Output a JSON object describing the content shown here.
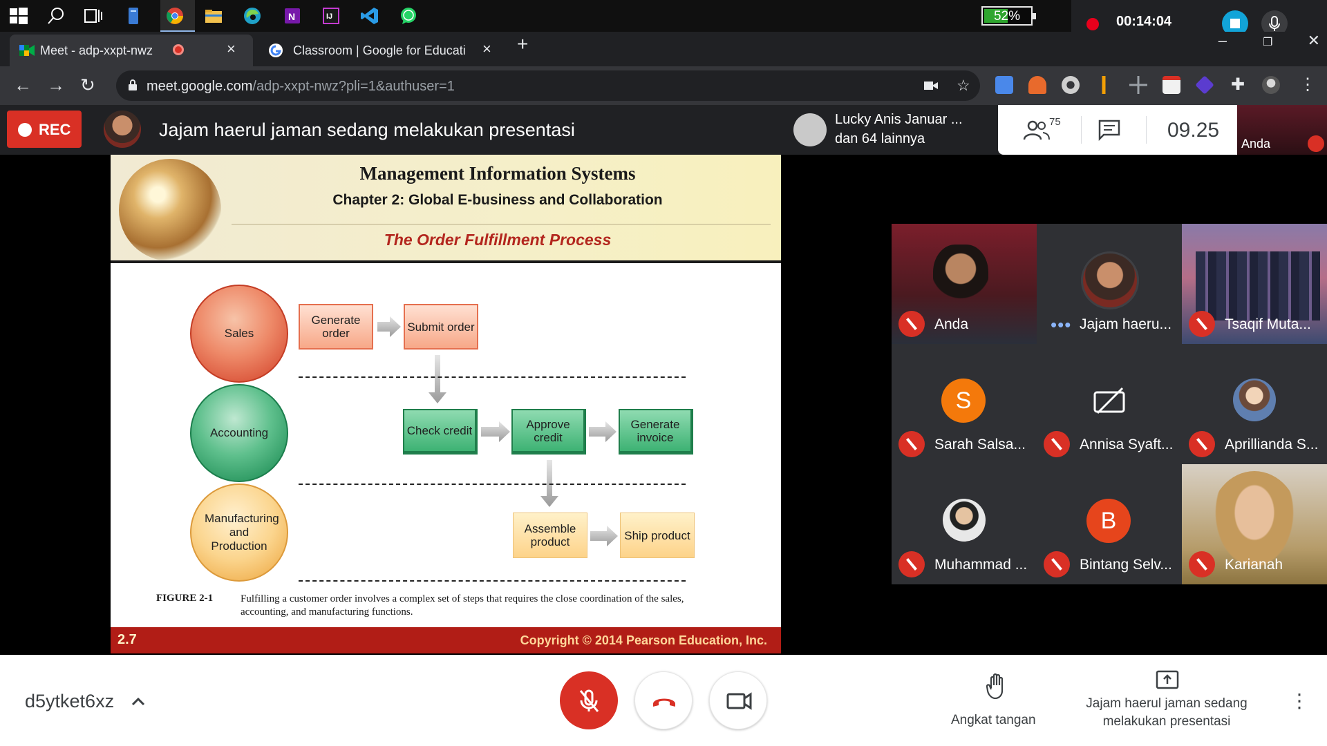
{
  "taskbar": {
    "battery": "52%",
    "battery_level": 0.52,
    "icons": [
      "windows-icon",
      "search-icon",
      "task-view-icon",
      "file-icon",
      "chrome-icon",
      "file-explorer-icon",
      "edge-icon",
      "onenote-icon",
      "intellij-icon",
      "vscode-icon",
      "whatsapp-icon"
    ]
  },
  "recorder": {
    "time": "00:14:04"
  },
  "browser": {
    "tabs": [
      {
        "title": "Meet - adp-xxpt-nwz"
      },
      {
        "title": "Classroom | Google for Education"
      }
    ],
    "url_host": "meet.google.com",
    "url_path": "/adp-xxpt-nwz?pli=1&authuser=1"
  },
  "meet": {
    "rec_label": "REC",
    "presenting_banner": "Jajam haerul jaman sedang melakukan presentasi",
    "lucky_name": "Lucky Anis Januar ...",
    "lucky_more": "dan 64 lainnya",
    "people_count": "75",
    "clock": "09.25",
    "self_label": "Anda"
  },
  "slide": {
    "title": "Management Information Systems",
    "subtitle": "Chapter 2: Global E-business and Collaboration",
    "section": "The Order Fulfillment Process",
    "circles": {
      "sales": "Sales",
      "accounting": "Accounting",
      "manufacturing": "Manufacturing and Production"
    },
    "boxes": {
      "generate_order": "Generate order",
      "submit_order": "Submit order",
      "check_credit": "Check credit",
      "approve_credit": "Approve credit",
      "generate_invoice": "Generate invoice",
      "assemble_product": "Assemble product",
      "ship_product": "Ship product"
    },
    "figure_label": "FIGURE 2-1",
    "figure_caption": "Fulfilling a customer order involves a complex set of steps that requires the close coordination of the sales, accounting, and manufacturing functions.",
    "slide_number": "2.7",
    "copyright": "Copyright © 2014 Pearson Education, Inc."
  },
  "participants": [
    {
      "name": "Anda",
      "muted": true
    },
    {
      "name": "Jajam haeru...",
      "muted": false
    },
    {
      "name": "Tsaqif Muta...",
      "muted": true
    },
    {
      "name": "Sarah Salsa...",
      "muted": true,
      "initial": "S",
      "color": "#f4790b"
    },
    {
      "name": "Annisa Syaft...",
      "muted": true
    },
    {
      "name": "Aprillianda S...",
      "muted": true
    },
    {
      "name": "Muhammad ...",
      "muted": true
    },
    {
      "name": "Bintang Selv...",
      "muted": true,
      "initial": "B",
      "color": "#e6451c"
    },
    {
      "name": "Karianah",
      "muted": true
    }
  ],
  "bottom": {
    "meeting_code": "d5ytket6xz",
    "raise_hand": "Angkat tangan",
    "present_label": "Jajam haerul jaman sedang melakukan presentasi"
  }
}
